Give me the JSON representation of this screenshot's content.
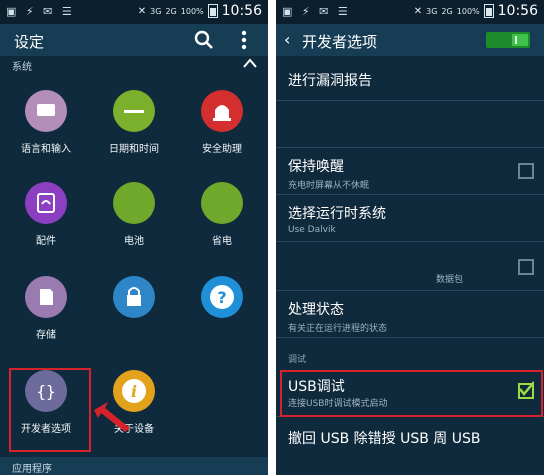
{
  "left": {
    "status": {
      "time": "10:56",
      "battery": "100%",
      "net1": "3G",
      "net2": "2G"
    },
    "title": "设定",
    "section": "系统",
    "tiles": [
      {
        "id": "language",
        "label": "语言和输入",
        "color": "#b38eb8",
        "icon": "keyboard-icon"
      },
      {
        "id": "datetime",
        "label": "日期和时间",
        "color": "#7bb02d",
        "icon": "clock-icon"
      },
      {
        "id": "safety",
        "label": "安全助理",
        "color": "#d32f2f",
        "icon": "siren-icon"
      },
      {
        "id": "accessory",
        "label": "配件",
        "color": "#8d3fc1",
        "icon": "accessory-icon"
      },
      {
        "id": "battery",
        "label": "电池",
        "color": "#6fa82b",
        "icon": "battery-icon"
      },
      {
        "id": "power",
        "label": "省电",
        "color": "#6fa82b",
        "icon": "leaf-icon"
      },
      {
        "id": "storage",
        "label": "存储",
        "color": "#9a7bb0",
        "icon": "sd-card-icon"
      },
      {
        "id": "security",
        "label": "",
        "color": "#2e86c8",
        "icon": "lock-icon"
      },
      {
        "id": "help",
        "label": "",
        "color": "#1f8fd8",
        "icon": "help-icon"
      },
      {
        "id": "developer",
        "label": "开发者选项",
        "color": "#6d6b9c",
        "icon": "braces-icon"
      },
      {
        "id": "about",
        "label": "关于设备",
        "color": "#e2a21b",
        "icon": "info-icon"
      }
    ],
    "bottom": "应用程序"
  },
  "right": {
    "status": {
      "time": "10:56",
      "battery": "100%",
      "net1": "3G",
      "net2": "2G"
    },
    "title": "开发者选项",
    "rows": [
      {
        "title": "进行漏洞报告",
        "sub": ""
      },
      {
        "title": "",
        "sub": ""
      },
      {
        "title": "保持唤醒",
        "sub": "充电时屏幕从不休眠",
        "checkbox": false
      },
      {
        "title": "选择运行时系统",
        "sub": "Use Dalvik"
      },
      {
        "title": "",
        "sub": "数据包",
        "checkbox": false
      },
      {
        "title": "处理状态",
        "sub": "有关正在运行进程的状态"
      },
      {
        "title": "USB调试",
        "sub": "连接USB时调试模式启动",
        "checkbox": true
      },
      {
        "title": "撤回 USB 除错授 USB 周 USB",
        "sub": ""
      }
    ],
    "debug_section": "调试"
  }
}
